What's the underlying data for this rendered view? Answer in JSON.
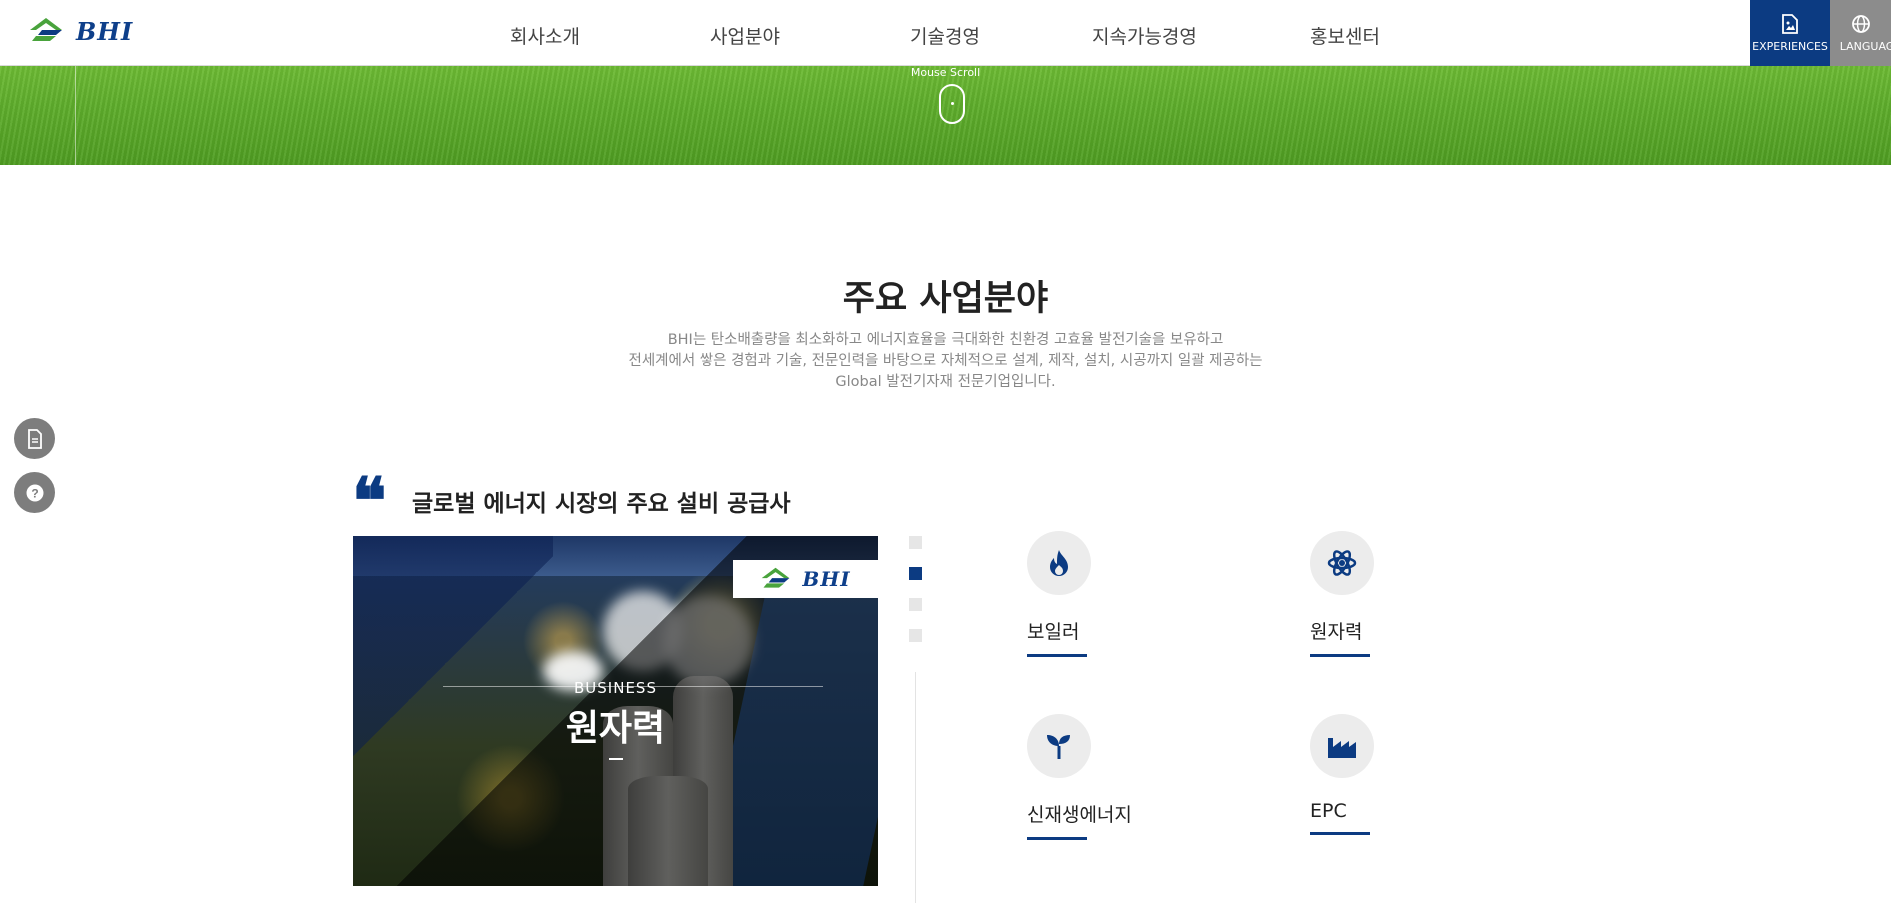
{
  "header": {
    "logo_text": "BHI",
    "nav": [
      "회사소개",
      "사업분야",
      "기술경영",
      "지속가능경영",
      "홍보센터"
    ],
    "experiences_label": "EXPERIENCES",
    "language_label": "LANGUAGE"
  },
  "hero": {
    "scroll_label": "Mouse Scroll"
  },
  "section": {
    "title": "주요 사업분야",
    "description": [
      "BHI는 탄소배출량을 최소화하고 에너지효율을 극대화한 친환경 고효율 발전기술을 보유하고",
      "전세계에서 쌓은 경험과 기술, 전문인력을 바탕으로 자체적으로 설계, 제작, 설치, 시공까지 일괄 제공하는",
      "Global 발전기자재 전문기업입니다."
    ],
    "subtitle": "글로벌 에너지 시장의 주요 설비 공급사"
  },
  "feature": {
    "logo_text": "BHI",
    "kicker": "BUSINESS",
    "title": "원자력"
  },
  "business": [
    {
      "label": "보일러",
      "icon": "flame-icon"
    },
    {
      "label": "원자력",
      "icon": "atom-icon"
    },
    {
      "label": "신재생에너지",
      "icon": "sprout-icon"
    },
    {
      "label": "EPC",
      "icon": "factory-icon"
    }
  ],
  "pager": {
    "count": 4,
    "active_index": 1
  },
  "colors": {
    "brand_blue": "#0c3b82",
    "brand_green": "#49a33c",
    "utility_gray": "#8c8c8c"
  }
}
